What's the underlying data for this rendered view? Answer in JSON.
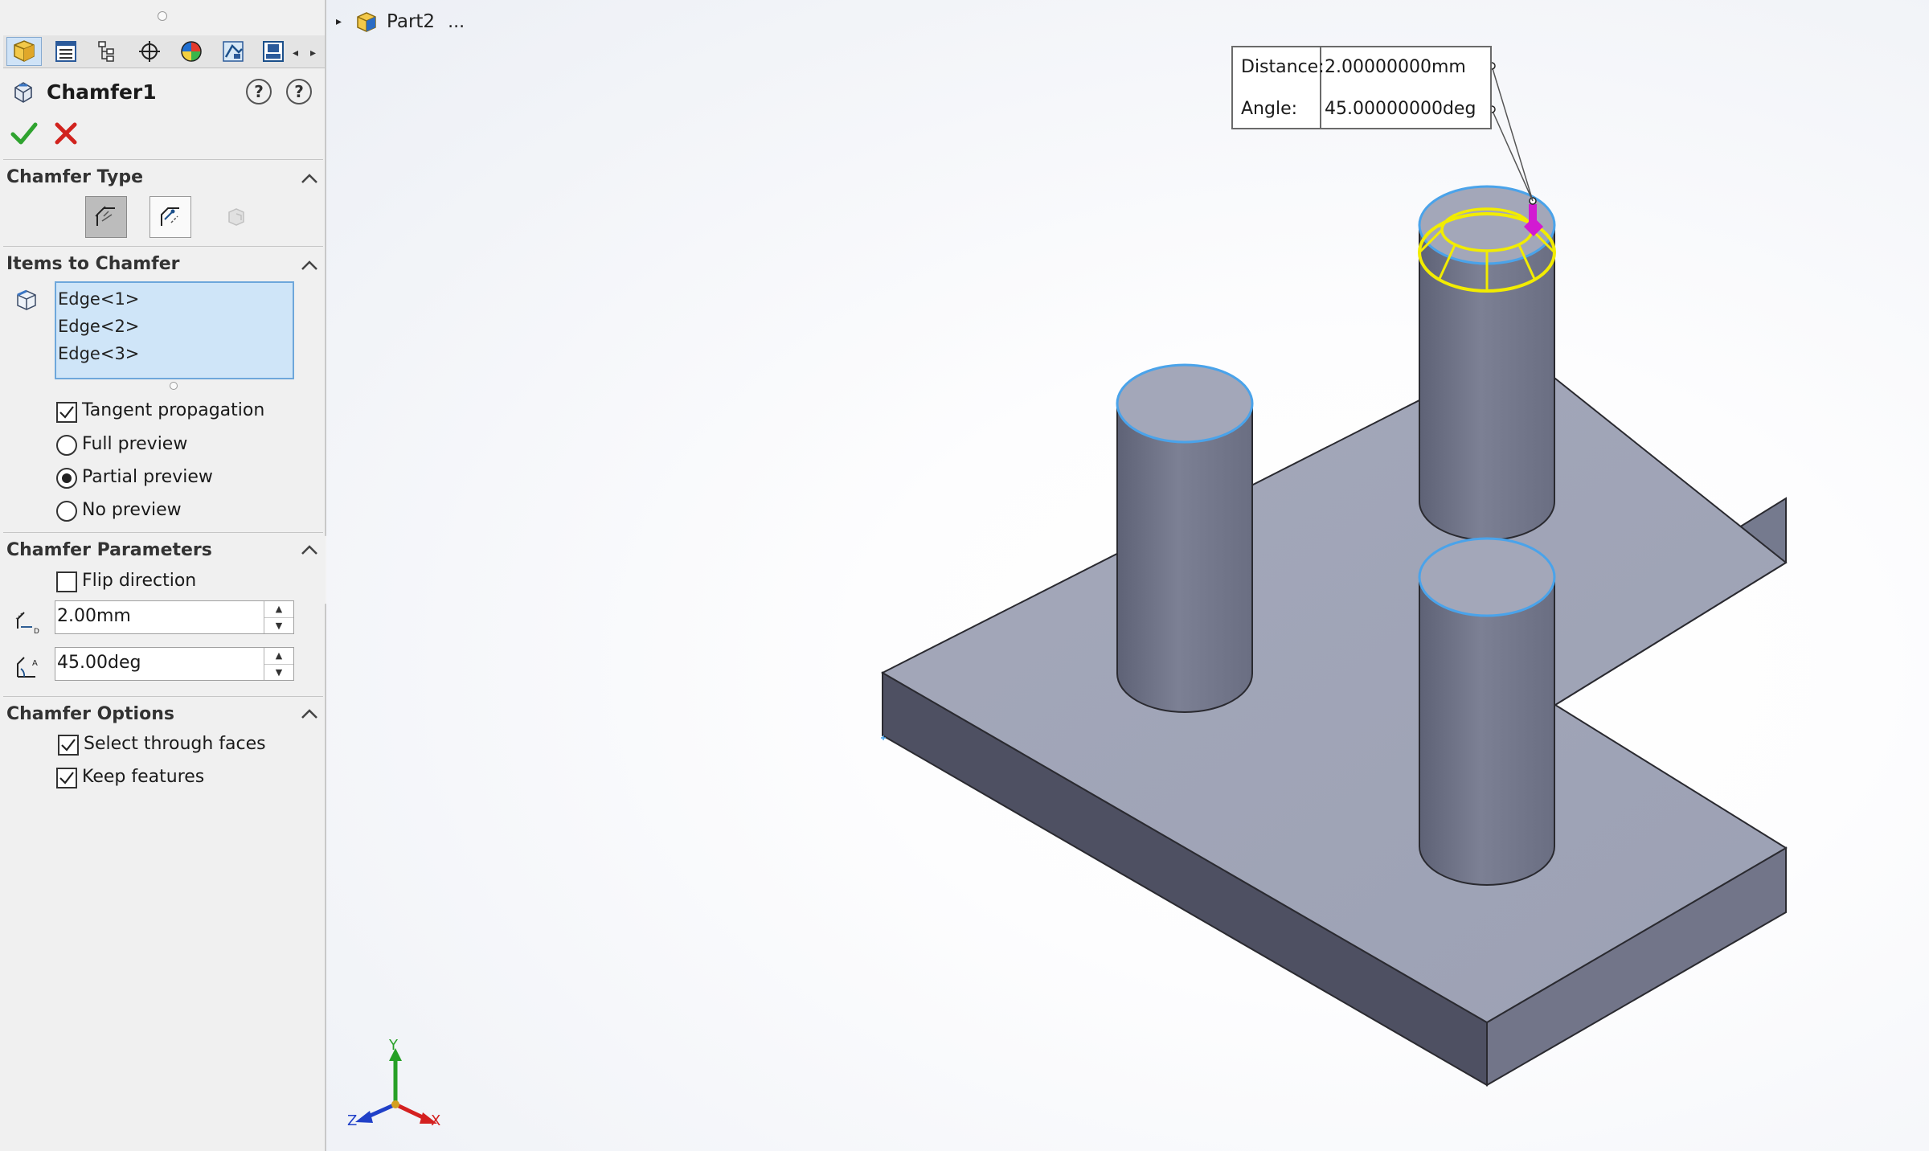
{
  "property_manager": {
    "tabs": [
      {
        "name": "feature-manager-tab-icon",
        "active": true
      },
      {
        "name": "property-manager-tab-icon",
        "active": false
      },
      {
        "name": "configuration-manager-tab-icon",
        "active": false
      },
      {
        "name": "dimxpert-manager-tab-icon",
        "active": false
      },
      {
        "name": "display-manager-tab-icon",
        "active": false
      },
      {
        "name": "cam-tab-icon",
        "active": false
      },
      {
        "name": "simulation-tab-icon",
        "active": false
      }
    ],
    "title": "Chamfer1",
    "help_labels": {
      "whats_wrong": "?",
      "help": "?"
    },
    "sections": {
      "chamfer_type": {
        "title": "Chamfer Type",
        "options": [
          {
            "name": "angle-distance",
            "selected": true
          },
          {
            "name": "vertex",
            "selected": false
          },
          {
            "name": "face-face",
            "selected": false,
            "disabled": true
          }
        ]
      },
      "items_to_chamfer": {
        "title": "Items to Chamfer",
        "items": [
          "Edge<1>",
          "Edge<2>",
          "Edge<3>"
        ],
        "tangent_propagation": {
          "label": "Tangent propagation",
          "checked": true
        },
        "preview_options": [
          {
            "label": "Full preview",
            "selected": false
          },
          {
            "label": "Partial preview",
            "selected": true
          },
          {
            "label": "No preview",
            "selected": false
          }
        ]
      },
      "chamfer_parameters": {
        "title": "Chamfer Parameters",
        "flip_direction": {
          "label": "Flip direction",
          "checked": false
        },
        "distance": "2.00mm",
        "angle": "45.00deg"
      },
      "chamfer_options": {
        "title": "Chamfer Options",
        "select_through_faces": {
          "label": "Select through faces",
          "checked": true
        },
        "keep_features": {
          "label": "Keep features",
          "checked": true
        }
      }
    }
  },
  "feature_tree": {
    "part_name": "Part2",
    "ellipsis": "..."
  },
  "callout": {
    "distance_label": "Distance:",
    "distance_value": "2.00000000mm",
    "angle_label": "Angle:",
    "angle_value": "45.00000000deg"
  },
  "triad": {
    "x": "X",
    "y": "Y",
    "z": "Z"
  },
  "colors": {
    "selection_edge": "#4aa3ea",
    "chamfer_preview": "#f2ec00",
    "ok_green": "#2fa32f",
    "cancel_red": "#d1231e",
    "list_highlight": "#cfe5f8"
  }
}
